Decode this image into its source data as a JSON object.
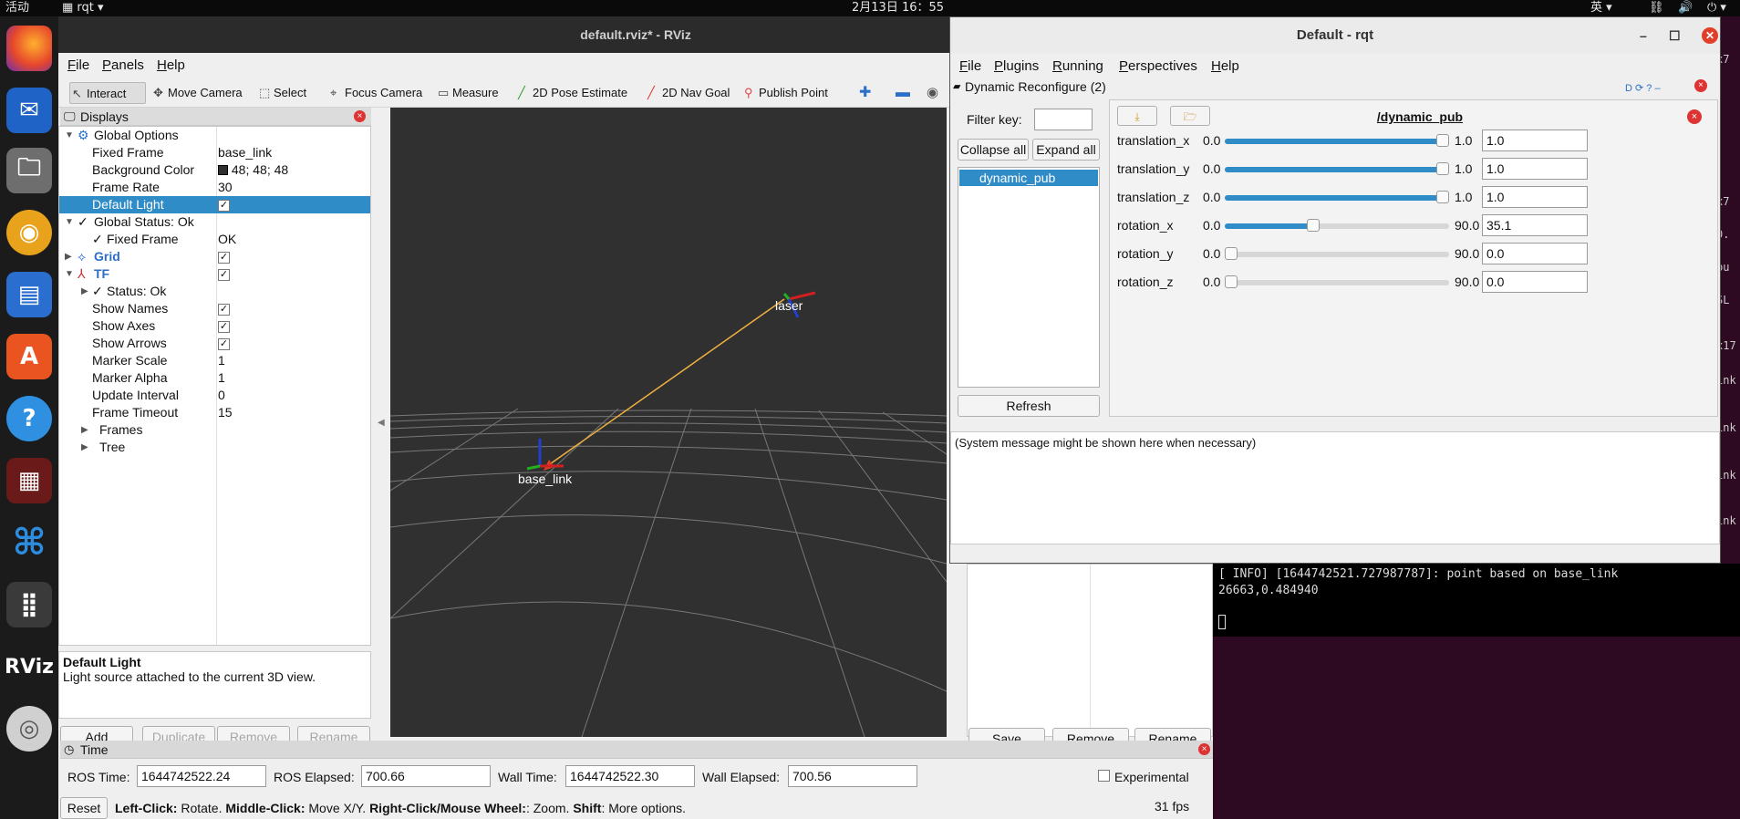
{
  "topbar": {
    "activities": "活动",
    "app": "rqt",
    "clock": "2月13日  16：55",
    "lang": "英"
  },
  "rviz": {
    "title": "default.rviz* - RViz",
    "menu": [
      "File",
      "Panels",
      "Help"
    ],
    "toolbar": [
      "Interact",
      "Move Camera",
      "Select",
      "Focus Camera",
      "Measure",
      "2D Pose Estimate",
      "2D Nav Goal",
      "Publish Point"
    ],
    "displays_title": "Displays",
    "tree": [
      {
        "label": "Global Options",
        "value": ""
      },
      {
        "label": "Fixed Frame",
        "value": "base_link"
      },
      {
        "label": "Background Color",
        "value": "48; 48; 48"
      },
      {
        "label": "Frame Rate",
        "value": "30"
      },
      {
        "label": "Default Light",
        "value": "✓"
      },
      {
        "label": "Global Status: Ok",
        "value": ""
      },
      {
        "label": "Fixed Frame",
        "value": "OK"
      },
      {
        "label": "Grid",
        "value": "✓"
      },
      {
        "label": "TF",
        "value": "✓"
      },
      {
        "label": "Status: Ok",
        "value": ""
      },
      {
        "label": "Show Names",
        "value": "✓"
      },
      {
        "label": "Show Axes",
        "value": "✓"
      },
      {
        "label": "Show Arrows",
        "value": "✓"
      },
      {
        "label": "Marker Scale",
        "value": "1"
      },
      {
        "label": "Marker Alpha",
        "value": "1"
      },
      {
        "label": "Update Interval",
        "value": "0"
      },
      {
        "label": "Frame Timeout",
        "value": "15"
      },
      {
        "label": "Frames",
        "value": ""
      },
      {
        "label": "Tree",
        "value": ""
      }
    ],
    "desc_title": "Default Light",
    "desc_text": "Light source attached to the current 3D view.",
    "buttons": {
      "add": "Add",
      "duplicate": "Duplicate",
      "remove": "Remove",
      "rename": "Rename"
    },
    "view": {
      "label_laser": "laser",
      "label_base": "base_link"
    },
    "right_buttons": {
      "save": "Save",
      "remove": "Remove",
      "rename": "Rename"
    },
    "time": {
      "title": "Time",
      "ros_time_label": "ROS Time:",
      "ros_time": "1644742522.24",
      "ros_elapsed_label": "ROS Elapsed:",
      "ros_elapsed": "700.66",
      "wall_time_label": "Wall Time:",
      "wall_time": "1644742522.30",
      "wall_elapsed_label": "Wall Elapsed:",
      "wall_elapsed": "700.56",
      "experimental": "Experimental",
      "reset": "Reset",
      "hint_b1": "Left-Click:",
      "hint_t1": " Rotate. ",
      "hint_b2": "Middle-Click:",
      "hint_t2": " Move X/Y. ",
      "hint_b3": "Right-Click/Mouse Wheel:",
      "hint_t3": ": Zoom. ",
      "hint_b4": "Shift",
      "hint_t4": ": More options.",
      "fps": "31 fps"
    }
  },
  "terminal": {
    "line1": "[ INFO] [1644742521.727987787]: point based on base_link",
    "line2": "26663,0.484940",
    "edge": [
      "x7",
      "x7",
      "0.",
      "bu",
      "SL",
      "x17",
      "ink",
      "ink",
      "ink",
      "ink"
    ]
  },
  "rqt": {
    "title": "Default - rqt",
    "menu": [
      "File",
      "Plugins",
      "Running",
      "Perspectives",
      "Help"
    ],
    "plugin_title": "Dynamic Reconfigure (2)",
    "filter_label": "Filter key:",
    "collapse": "Collapse all",
    "expand": "Expand all",
    "node_item": "dynamic_pub",
    "refresh": "Refresh",
    "node_title": "/dynamic_pub",
    "params": [
      {
        "name": "translation_x",
        "min": "0.0",
        "max": "1.0",
        "value": "1.0",
        "fraction": 1.0
      },
      {
        "name": "translation_y",
        "min": "0.0",
        "max": "1.0",
        "value": "1.0",
        "fraction": 1.0
      },
      {
        "name": "translation_z",
        "min": "0.0",
        "max": "1.0",
        "value": "1.0",
        "fraction": 1.0
      },
      {
        "name": "rotation_x",
        "min": "0.0",
        "max": "90.0",
        "value": "35.1",
        "fraction": 0.39
      },
      {
        "name": "rotation_y",
        "min": "0.0",
        "max": "90.0",
        "value": "0.0",
        "fraction": 0.0
      },
      {
        "name": "rotation_z",
        "min": "0.0",
        "max": "90.0",
        "value": "0.0",
        "fraction": 0.0
      }
    ],
    "system_message": "(System message might be shown here when necessary)"
  },
  "colors": {
    "accent": "#308cc6",
    "background_3d": "#303030",
    "tf_line": "#f0b040",
    "terminal_bg": "#2d0922"
  }
}
